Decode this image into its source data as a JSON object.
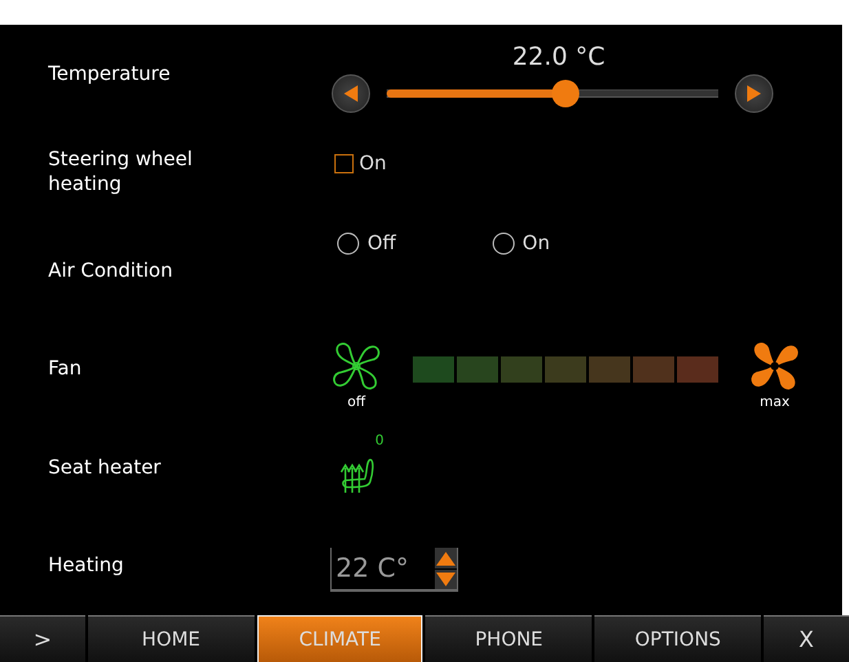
{
  "rows": [
    {
      "kind": "slider",
      "label": "Temperature",
      "reading": "22.0 °C",
      "level": 0.54
    },
    {
      "kind": "checkbox",
      "label": "Steering wheel heating",
      "option": "On",
      "checked": false
    },
    {
      "kind": "radio",
      "label": "Air Condition",
      "options": [
        {
          "label": "Off",
          "selected": false
        },
        {
          "label": "On",
          "selected": false
        }
      ]
    },
    {
      "kind": "fan",
      "label": "Fan",
      "min_label": "off",
      "max_label": "max"
    },
    {
      "kind": "seat",
      "label": "Seat heater",
      "reading": "0"
    },
    {
      "kind": "spinner",
      "label": "Heating",
      "value": "22 C°"
    }
  ],
  "nav": [
    {
      "label": ">",
      "selected": false
    },
    {
      "label": "HOME",
      "selected": false
    },
    {
      "label": "CLIMATE",
      "selected": true
    },
    {
      "label": "PHONE",
      "selected": false
    },
    {
      "label": "OPTIONS",
      "selected": false
    },
    {
      "label": "X",
      "selected": false
    }
  ]
}
